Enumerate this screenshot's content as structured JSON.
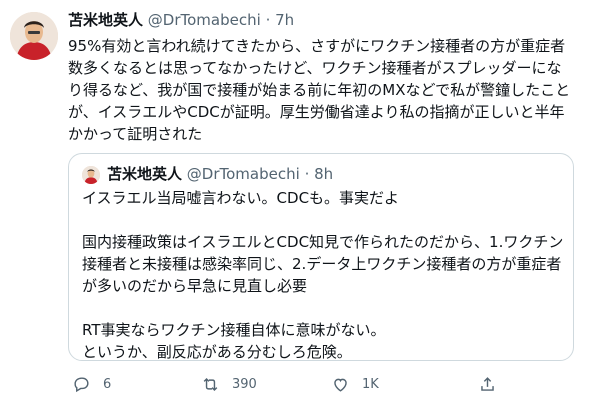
{
  "tweet": {
    "author_name": "苫米地英人",
    "author_handle": "@DrTomabechi",
    "separator": "·",
    "time": "7h",
    "text_lines": [
      "95%有効と言われ続けてきたから、さすがにワクチン接種者の方が重症者",
      "数多くなるとは思ってなかったけど、ワクチン接種者がスプレッダーにな",
      "り得るなど、我が国で接種が始まる前に年初のMXなどで私が警鐘したこと",
      "が、イスラエルやCDCが証明。厚生労働省達より私の指摘が正しいと半年",
      "かかって証明された"
    ]
  },
  "quote": {
    "author_name": "苫米地英人",
    "author_handle": "@DrTomabechi",
    "separator": "·",
    "time": "8h",
    "text_lines": [
      "イスラエル当局嘘言わない。CDCも。事実だよ",
      "",
      "国内接種政策はイスラエルとCDC知見で作られたのだから、1.ワクチン",
      "接種者と未接種は感染率同じ、2.データ上ワクチン接種者の方が重症者",
      "が多いのだから早急に見直し必要",
      "",
      "RT事実ならワクチン接種自体に意味がない。",
      "というか、副反応がある分むしろ危険。"
    ]
  },
  "actions": {
    "reply_count": "6",
    "retweet_count": "390",
    "like_count": "1K",
    "icons": [
      "reply-icon",
      "retweet-icon",
      "like-icon",
      "share-icon"
    ]
  },
  "colors": {
    "text": "#0f1419",
    "secondary": "#536471",
    "border": "#cfd9de"
  }
}
